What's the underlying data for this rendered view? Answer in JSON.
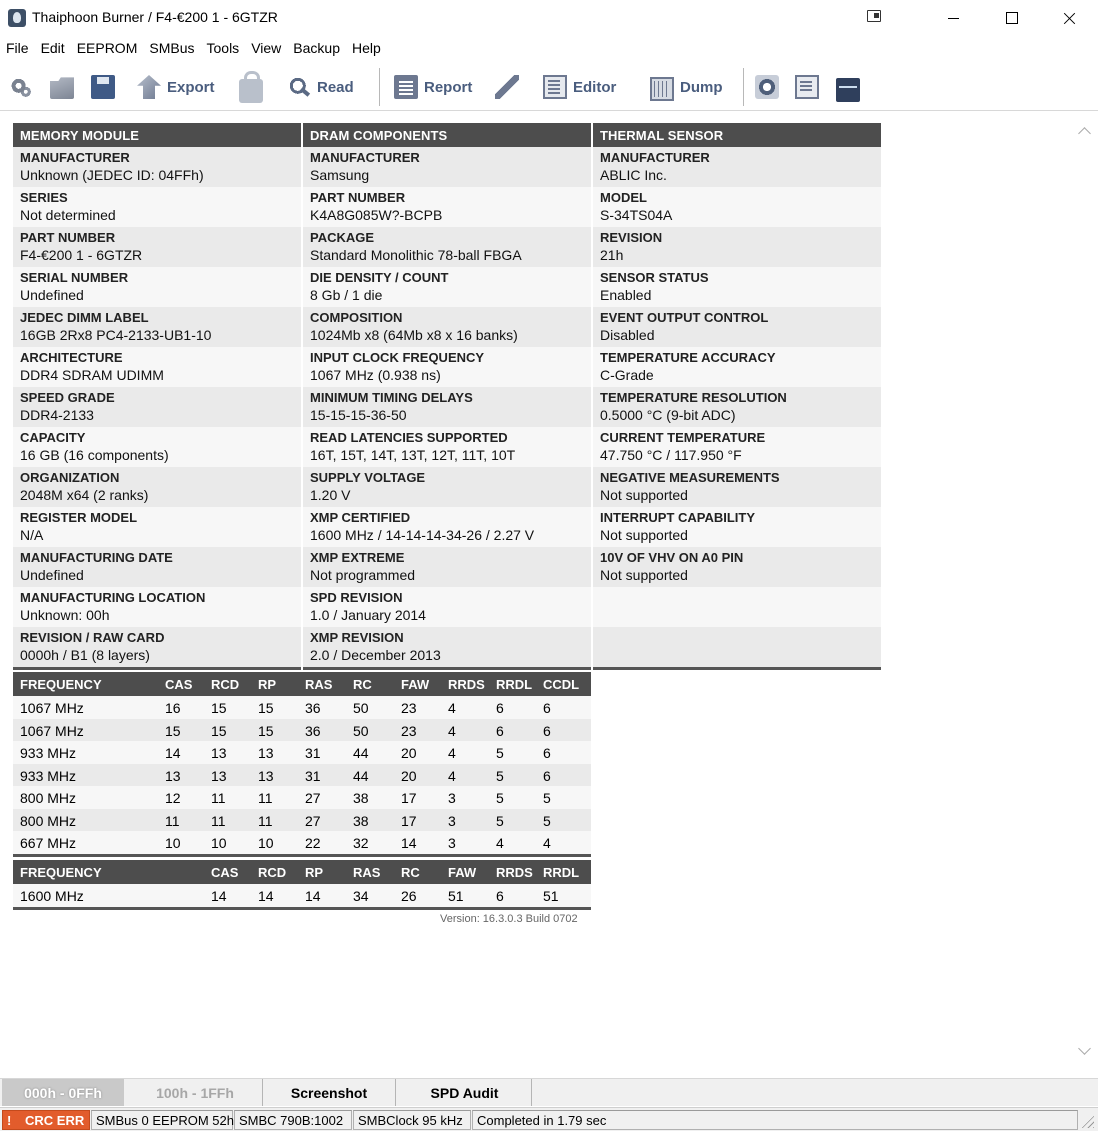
{
  "window": {
    "title": "Thaiphoon Burner / F4-€200 1 - 6GTZR"
  },
  "menu": [
    "File",
    "Edit",
    "EEPROM",
    "SMBus",
    "Tools",
    "View",
    "Backup",
    "Help"
  ],
  "toolbar": {
    "export_label": "Export",
    "read_label": "Read",
    "report_label": "Report",
    "editor_label": "Editor",
    "dump_label": "Dump"
  },
  "memory_module": {
    "header": "MEMORY MODULE",
    "rows": [
      {
        "k": "MANUFACTURER",
        "v": "Unknown (JEDEC ID: 04FFh)"
      },
      {
        "k": "SERIES",
        "v": "Not determined"
      },
      {
        "k": "PART NUMBER",
        "v": "F4-€200 1 - 6GTZR"
      },
      {
        "k": "SERIAL NUMBER",
        "v": "Undefined"
      },
      {
        "k": "JEDEC DIMM LABEL",
        "v": "16GB 2Rx8 PC4-2133-UB1-10"
      },
      {
        "k": "ARCHITECTURE",
        "v": "DDR4 SDRAM UDIMM"
      },
      {
        "k": "SPEED GRADE",
        "v": "DDR4-2133"
      },
      {
        "k": "CAPACITY",
        "v": "16 GB (16 components)"
      },
      {
        "k": "ORGANIZATION",
        "v": "2048M x64 (2 ranks)"
      },
      {
        "k": "REGISTER MODEL",
        "v": "N/A"
      },
      {
        "k": "MANUFACTURING DATE",
        "v": "Undefined"
      },
      {
        "k": "MANUFACTURING LOCATION",
        "v": "Unknown: 00h"
      },
      {
        "k": "REVISION / RAW CARD",
        "v": "0000h / B1 (8 layers)"
      }
    ]
  },
  "dram_components": {
    "header": "DRAM COMPONENTS",
    "rows": [
      {
        "k": "MANUFACTURER",
        "v": "Samsung"
      },
      {
        "k": "PART NUMBER",
        "v": "K4A8G085W?-BCPB"
      },
      {
        "k": "PACKAGE",
        "v": "Standard Monolithic 78-ball FBGA"
      },
      {
        "k": "DIE DENSITY / COUNT",
        "v": "8 Gb / 1 die"
      },
      {
        "k": "COMPOSITION",
        "v": "1024Mb x8 (64Mb x8 x 16 banks)"
      },
      {
        "k": "INPUT CLOCK FREQUENCY",
        "v": "1067 MHz (0.938 ns)"
      },
      {
        "k": "MINIMUM TIMING DELAYS",
        "v": "15-15-15-36-50"
      },
      {
        "k": "READ LATENCIES SUPPORTED",
        "v": "16T, 15T, 14T, 13T, 12T, 11T, 10T"
      },
      {
        "k": "SUPPLY VOLTAGE",
        "v": "1.20 V"
      },
      {
        "k": "XMP CERTIFIED",
        "v": "1600 MHz / 14-14-14-34-26 / 2.27 V"
      },
      {
        "k": "XMP EXTREME",
        "v": "Not programmed"
      },
      {
        "k": "SPD REVISION",
        "v": "1.0 / January 2014"
      },
      {
        "k": "XMP REVISION",
        "v": "2.0 / December 2013"
      }
    ]
  },
  "thermal_sensor": {
    "header": "THERMAL SENSOR",
    "rows": [
      {
        "k": "MANUFACTURER",
        "v": "ABLIC Inc."
      },
      {
        "k": "MODEL",
        "v": "S-34TS04A"
      },
      {
        "k": "REVISION",
        "v": "21h"
      },
      {
        "k": "SENSOR STATUS",
        "v": "Enabled"
      },
      {
        "k": "EVENT OUTPUT CONTROL",
        "v": "Disabled"
      },
      {
        "k": "TEMPERATURE ACCURACY",
        "v": "C-Grade"
      },
      {
        "k": "TEMPERATURE RESOLUTION",
        "v": "0.5000 °C (9-bit ADC)"
      },
      {
        "k": "CURRENT TEMPERATURE",
        "v": "47.750 °C / 117.950 °F"
      },
      {
        "k": "NEGATIVE MEASUREMENTS",
        "v": "Not supported"
      },
      {
        "k": "INTERRUPT CAPABILITY",
        "v": "Not supported"
      },
      {
        "k": "10V OF VHV ON A0 PIN",
        "v": "Not supported"
      },
      {
        "k": "",
        "v": ""
      },
      {
        "k": "",
        "v": ""
      }
    ]
  },
  "jedec_timings": {
    "headers": [
      "FREQUENCY",
      "CAS",
      "RCD",
      "RP",
      "RAS",
      "RC",
      "FAW",
      "RRDS",
      "RRDL",
      "CCDL"
    ],
    "rows": [
      [
        "1067 MHz",
        "16",
        "15",
        "15",
        "36",
        "50",
        "23",
        "4",
        "6",
        "6"
      ],
      [
        "1067 MHz",
        "15",
        "15",
        "15",
        "36",
        "50",
        "23",
        "4",
        "6",
        "6"
      ],
      [
        "933 MHz",
        "14",
        "13",
        "13",
        "31",
        "44",
        "20",
        "4",
        "5",
        "6"
      ],
      [
        "933 MHz",
        "13",
        "13",
        "13",
        "31",
        "44",
        "20",
        "4",
        "5",
        "6"
      ],
      [
        "800 MHz",
        "12",
        "11",
        "11",
        "27",
        "38",
        "17",
        "3",
        "5",
        "5"
      ],
      [
        "800 MHz",
        "11",
        "11",
        "11",
        "27",
        "38",
        "17",
        "3",
        "5",
        "5"
      ],
      [
        "667 MHz",
        "10",
        "10",
        "10",
        "22",
        "32",
        "14",
        "3",
        "4",
        "4"
      ]
    ]
  },
  "xmp_timings": {
    "headers": [
      "FREQUENCY",
      "CAS",
      "RCD",
      "RP",
      "RAS",
      "RC",
      "FAW",
      "RRDS",
      "RRDL"
    ],
    "rows": [
      [
        "1600 MHz",
        "14",
        "14",
        "14",
        "34",
        "26",
        "51",
        "6",
        "51"
      ]
    ]
  },
  "version": "Version: 16.3.0.3 Build 0702",
  "tabs": [
    "000h - 0FFh",
    "100h - 1FFh",
    "Screenshot",
    "SPD Audit"
  ],
  "status": {
    "error": "CRC ERR",
    "bus": "SMBus 0 EEPROM 52h",
    "controller": "SMBC 790B:1002",
    "clock": "SMBClock 95 kHz",
    "completed": "Completed in 1.79 sec"
  }
}
